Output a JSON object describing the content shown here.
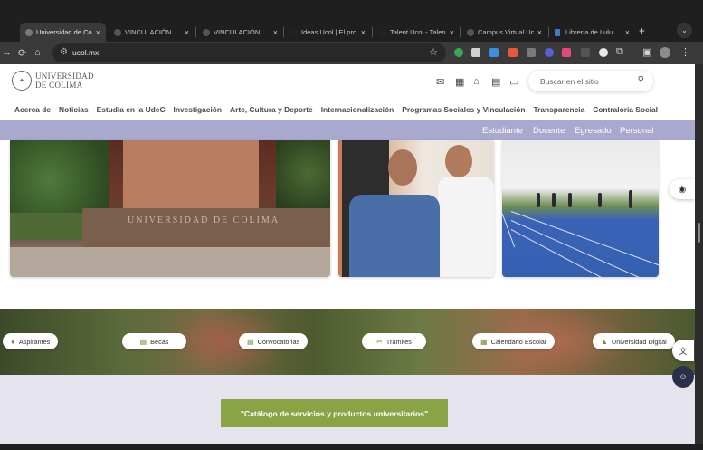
{
  "browser": {
    "tabs": [
      {
        "title": "Universidad de Co",
        "active": true
      },
      {
        "title": "VINCULACIÓN",
        "active": false
      },
      {
        "title": "VINCULACIÓN",
        "active": false
      },
      {
        "title": "Ideas Ucol | El pro",
        "active": false
      },
      {
        "title": "Talent Ucol - Talen",
        "active": false
      },
      {
        "title": "Campus Virtual Uc",
        "active": false
      },
      {
        "title": "Librería de Lulu",
        "active": false
      }
    ],
    "close_glyph": "×",
    "newtab_glyph": "+",
    "url": "ucol.mx"
  },
  "site": {
    "logo": {
      "line1": "UNIVERSIDAD",
      "line2": "DE COLIMA",
      "seal_icon": "university-seal-icon"
    },
    "search": {
      "placeholder": "Buscar en el sitio"
    },
    "main_nav": [
      "Acerca de",
      "Noticias",
      "Estudia en la UdeC",
      "Investigación",
      "Arte, Cultura y Deporte",
      "Internacionalización",
      "Programas Sociales y Vinculación",
      "Transparencia",
      "Contraloría Social"
    ],
    "audiences": [
      "Estudiante",
      "Docente",
      "Egresado",
      "Personal"
    ],
    "photo1_text": "UNIVERSIDAD DE COLIMA",
    "quick_links": [
      {
        "label": "Aspirantes",
        "icon": "user-icon"
      },
      {
        "label": "Becas",
        "icon": "document-icon"
      },
      {
        "label": "Convocatorias",
        "icon": "document-icon"
      },
      {
        "label": "Trámites",
        "icon": "tools-icon"
      },
      {
        "label": "Calendario Escolar",
        "icon": "calendar-icon"
      },
      {
        "label": "Universidad Digital",
        "icon": "graduation-cap-icon"
      }
    ],
    "catalog_button": "\"Catálogo de servicios y productos universitarios\"",
    "colors": {
      "audience_bar": "#a9a9cf",
      "catalog_button": "#8aa445",
      "catalog_bg": "#e4e3ee"
    }
  }
}
